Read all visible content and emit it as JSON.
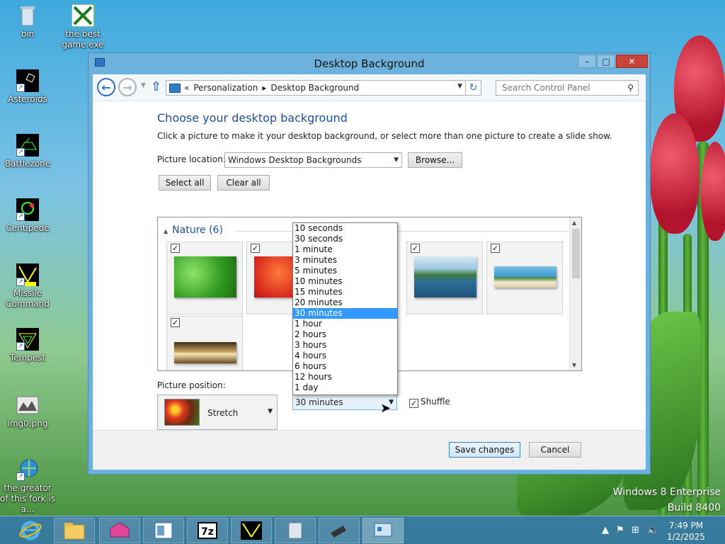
{
  "desktop": {
    "icons": [
      {
        "label": "bin"
      },
      {
        "label": "the best game.exe"
      },
      {
        "label": "Asteroids"
      },
      {
        "label": "Battlezone"
      },
      {
        "label": "Centipede"
      },
      {
        "label": "Missile Command"
      },
      {
        "label": "Tempest"
      },
      {
        "label": "img0.png"
      },
      {
        "label": "the greator of this fork is a..."
      }
    ],
    "watermark": {
      "line1": "Windows 8 Enterprise",
      "line2": "Build 8400"
    }
  },
  "window": {
    "title": "Desktop Background",
    "nav": {
      "breadcrumb_prefix": "«",
      "crumbs": [
        "Personalization",
        "Desktop Background"
      ],
      "search_placeholder": "Search Control Panel"
    },
    "heading": "Choose your desktop background",
    "description": "Click a picture to make it your desktop background, or select more than one picture to create a slide show.",
    "picture_location": {
      "label": "Picture location:",
      "value": "Windows Desktop Backgrounds",
      "browse_label": "Browse..."
    },
    "select_all_label": "Select all",
    "clear_all_label": "Clear all",
    "group": {
      "name": "Nature (6)"
    },
    "picture_position": {
      "label": "Picture position:",
      "value": "Stretch"
    },
    "interval": {
      "selected": "30 minutes",
      "options": [
        "10 seconds",
        "30 seconds",
        "1 minute",
        "3 minutes",
        "5 minutes",
        "10 minutes",
        "15 minutes",
        "20 minutes",
        "30 minutes",
        "1 hour",
        "2 hours",
        "3 hours",
        "4 hours",
        "6 hours",
        "12 hours",
        "1 day"
      ]
    },
    "shuffle_label": "Shuffle",
    "save_label": "Save changes",
    "cancel_label": "Cancel"
  },
  "taskbar": {
    "clock_time": "7:49 PM",
    "clock_date": "1/2/2025"
  },
  "colors": {
    "accent": "#1f4f9a",
    "selection": "#3399ff",
    "window_frame": "#6db2dd",
    "taskbar": "#3778aa"
  }
}
